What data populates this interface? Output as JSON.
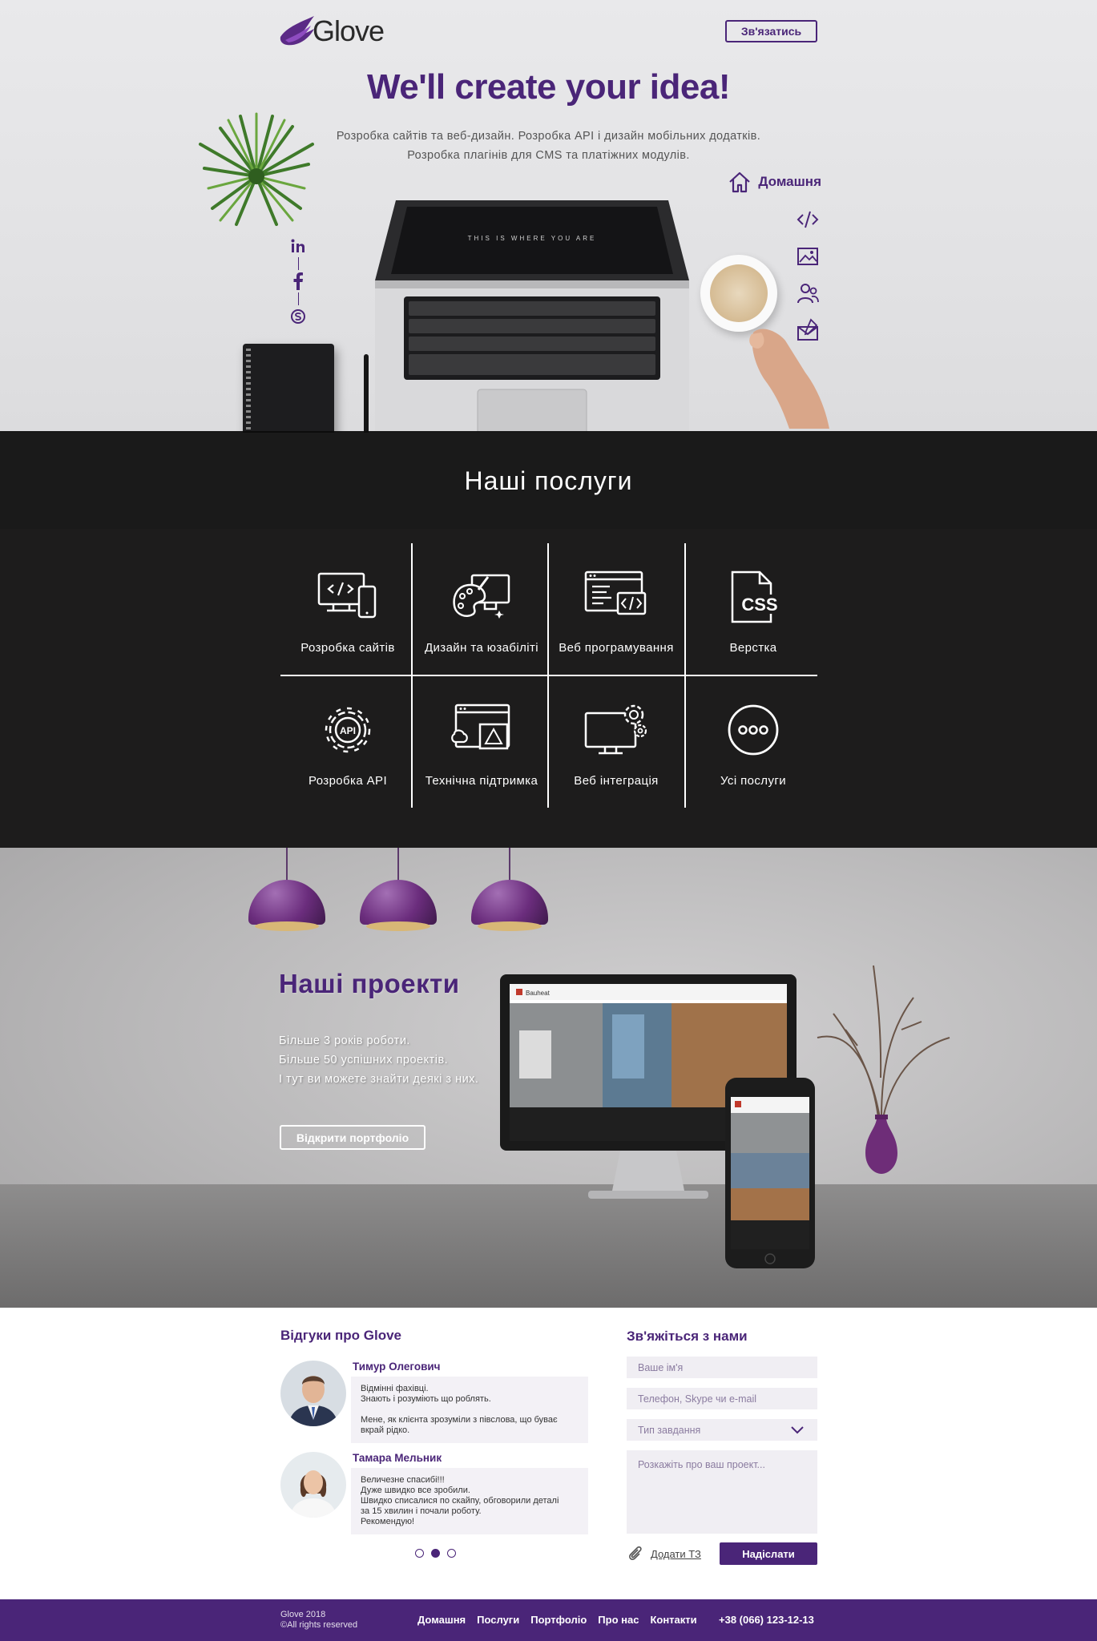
{
  "header": {
    "logo_text": "Glove",
    "contact_button": "Зв'язатись",
    "title": "We'll create your idea!",
    "subtitle_line1": "Розробка сайтів та веб-дизайн. Розробка API і дизайн мобільних додатків.",
    "subtitle_line2": "Розробка плагінів для CMS та платіжних модулів.",
    "home_link": "Домашня",
    "laptop_screen_text": "THIS IS WHERE YOU ARE"
  },
  "social_icons": [
    "linkedin-icon",
    "facebook-icon",
    "skype-icon"
  ],
  "side_nav_icons": [
    "code-icon",
    "image-icon",
    "people-icon",
    "mail-icon"
  ],
  "services": {
    "title": "Наші послуги",
    "items": [
      {
        "label": "Розробка сайтів",
        "icon": "devices-code-icon"
      },
      {
        "label": "Дизайн та юзабіліті",
        "icon": "palette-icon"
      },
      {
        "label": "Веб програмування",
        "icon": "browser-code-icon"
      },
      {
        "label": "Верстка",
        "icon": "css-file-icon"
      },
      {
        "label": "Розробка API",
        "icon": "api-gear-icon"
      },
      {
        "label": "Технічна підтримка",
        "icon": "support-windows-icon"
      },
      {
        "label": "Веб інтеграція",
        "icon": "monitor-gears-icon"
      },
      {
        "label": "Усі послуги",
        "icon": "more-icon"
      }
    ]
  },
  "projects": {
    "title": "Наші проекти",
    "line1": "Більше 3 років роботи.",
    "line2": "Більше 50 успішних проектів.",
    "line3": "І тут ви можете знайти деякі з них.",
    "button": "Відкрити портфоліо",
    "mockup_brand": "Bauheat"
  },
  "reviews": {
    "title": "Відгуки про Glove",
    "items": [
      {
        "name": "Тимур Олегович",
        "p1a": "Відмінні фахівці.",
        "p1b": "Знають і розуміють що роблять.",
        "p2a": "Мене, як клієнта зрозуміли з півслова, що буває",
        "p2b": "вкрай рідко."
      },
      {
        "name": "Тамара Мельник",
        "l1": "Величезне спасибі!!!",
        "l2": "Дуже швидко все зробили.",
        "l3": "Швидко списалися по скайпу, обговорили деталі",
        "l4": "за 15 хвилин і почали роботу.",
        "l5": "Рекомендую!"
      }
    ],
    "active_slide": 2,
    "slide_count": 3
  },
  "contact": {
    "title": "Зв'яжіться з нами",
    "name_placeholder": "Ваше ім'я",
    "phone_placeholder": "Телефон, Skype чи e-mail",
    "type_placeholder": "Тип завдання",
    "message_placeholder": "Розкажіть про ваш проект...",
    "attach_label": "Додати ТЗ",
    "send_button": "Надіслати"
  },
  "footer": {
    "copyright_line1": "Glove 2018",
    "copyright_line2": "©All rights reserved",
    "nav": [
      "Домашня",
      "Послуги",
      "Портфоліо",
      "Про нас",
      "Контакти"
    ],
    "phone": "+38 (066) 123-12-13"
  },
  "colors": {
    "brand_purple": "#4a2578",
    "dark_band": "#1d1c1c",
    "footer_bg": "#4a2578"
  }
}
